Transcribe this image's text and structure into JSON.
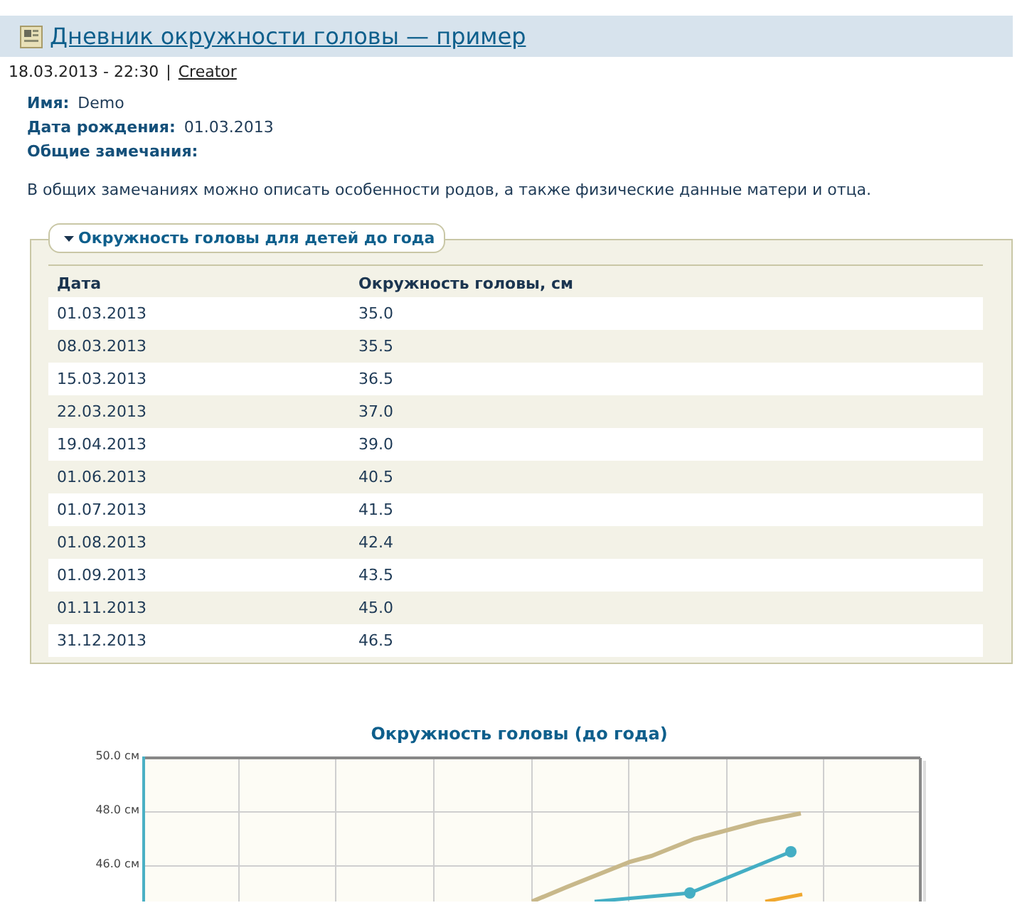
{
  "title": "Дневник окружности головы — пример",
  "meta": {
    "date": "18.03.2013 - 22:30",
    "separator": "|",
    "author": "Creator"
  },
  "fields": [
    {
      "label": "Имя:",
      "value": "Demo"
    },
    {
      "label": "Дата рождения:",
      "value": "01.03.2013"
    },
    {
      "label": "Общие замечания:"
    }
  ],
  "note": "В общих замечаниях можно описать особенности родов, а также физические данные матери и отца.",
  "section": {
    "legend": "Окружность головы для детей до года",
    "expanded": true,
    "table": {
      "columns": [
        "Дата",
        "Окружность головы, см"
      ],
      "rows": [
        [
          "01.03.2013",
          "35.0"
        ],
        [
          "08.03.2013",
          "35.5"
        ],
        [
          "15.03.2013",
          "36.5"
        ],
        [
          "22.03.2013",
          "37.0"
        ],
        [
          "19.04.2013",
          "39.0"
        ],
        [
          "01.06.2013",
          "40.5"
        ],
        [
          "01.07.2013",
          "41.5"
        ],
        [
          "01.08.2013",
          "42.4"
        ],
        [
          "01.09.2013",
          "43.5"
        ],
        [
          "01.11.2013",
          "45.0"
        ],
        [
          "31.12.2013",
          "46.5"
        ]
      ]
    }
  },
  "chart": {
    "title": "Окружность головы (до года)",
    "y_ticks": [
      "50.0 см",
      "48.0 см",
      "46.0 см"
    ]
  }
}
